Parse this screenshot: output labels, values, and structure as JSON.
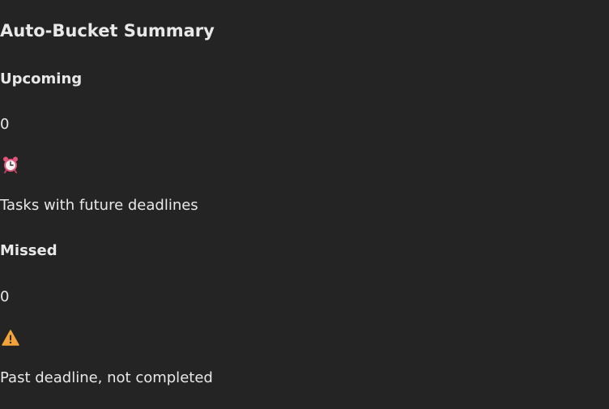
{
  "title": "Auto-Bucket Summary",
  "buckets": [
    {
      "heading": "Upcoming",
      "count": "0",
      "icon": "alarm-clock-icon",
      "description": "Tasks with future deadlines"
    },
    {
      "heading": "Missed",
      "count": "0",
      "icon": "warning-icon",
      "description": "Past deadline, not completed"
    }
  ],
  "colors": {
    "background": "#242424",
    "text": "#e8e8e8",
    "alarm_clock": "#e0567a",
    "warning": "#f2a33a"
  }
}
